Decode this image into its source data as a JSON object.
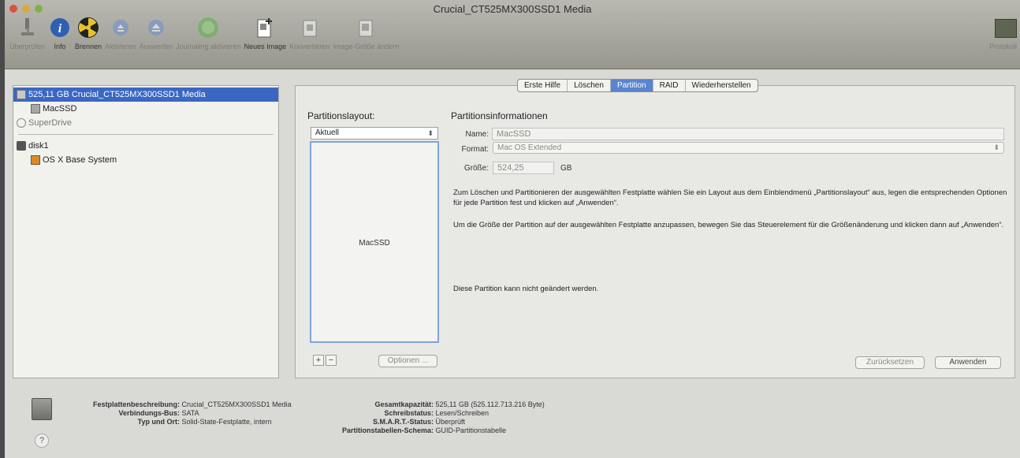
{
  "window": {
    "title": "Crucial_CT525MX300SSD1 Media"
  },
  "toolbar": {
    "items": [
      {
        "label": "Überprüfen",
        "icon": "microscope-icon",
        "disabled": true
      },
      {
        "label": "Info",
        "icon": "info-icon",
        "disabled": false
      },
      {
        "label": "Brennen",
        "icon": "burn-icon",
        "disabled": false
      },
      {
        "label": "Aktivieren",
        "icon": "mount-icon",
        "disabled": true
      },
      {
        "label": "Auswerfen",
        "icon": "eject-icon",
        "disabled": true
      },
      {
        "label": "Journaling aktivieren",
        "icon": "journaling-icon",
        "disabled": true
      },
      {
        "label": "Neues Image",
        "icon": "new-image-icon",
        "disabled": false
      },
      {
        "label": "Konvertieren",
        "icon": "convert-icon",
        "disabled": true
      },
      {
        "label": "Image-Größe ändern",
        "icon": "resize-image-icon",
        "disabled": true
      }
    ],
    "log_label": "Protokoll"
  },
  "sidebar": {
    "items": [
      {
        "label": "525,11 GB Crucial_CT525MX300SSD1 Media",
        "selected": true,
        "indent": 0,
        "icon": "disk-icon"
      },
      {
        "label": "MacSSD",
        "selected": false,
        "indent": 1,
        "icon": "volume-icon"
      },
      {
        "label": "SuperDrive",
        "selected": false,
        "indent": 0,
        "icon": "optical-drive-icon",
        "muted": true
      },
      {
        "separator": true
      },
      {
        "label": "disk1",
        "selected": false,
        "indent": 0,
        "icon": "image-disk-icon"
      },
      {
        "label": "OS X Base System",
        "selected": false,
        "indent": 1,
        "icon": "volume-orange-icon"
      }
    ]
  },
  "tabs": [
    "Erste Hilfe",
    "Löschen",
    "Partition",
    "RAID",
    "Wiederherstellen"
  ],
  "active_tab": "Partition",
  "layout": {
    "heading": "Partitionslayout:",
    "select_value": "Aktuell",
    "partition_label": "MacSSD",
    "add_label": "+",
    "remove_label": "−",
    "options_label": "Optionen ..."
  },
  "info": {
    "heading": "Partitionsinformationen",
    "name_label": "Name:",
    "name_value": "MacSSD",
    "format_label": "Format:",
    "format_value": "Mac OS Extended",
    "size_label": "Größe:",
    "size_value": "524,25",
    "size_unit": "GB",
    "para1": "Zum Löschen und Partitionieren der ausgewählten Festplatte wählen Sie ein Layout aus dem Einblendmenü „Partitionslayout“ aus, legen die entsprechenden Optionen für jede Partition fest und klicken auf „Anwenden“.",
    "para2": "Um die Größe der Partition auf der ausgewählten Festplatte anzupassen, bewegen Sie das Steuerelement für die Größenänderung und klicken dann auf „Anwenden“.",
    "para3": "Diese Partition kann nicht geändert werden.",
    "revert_label": "Zurücksetzen",
    "apply_label": "Anwenden"
  },
  "details": {
    "left": [
      {
        "key": "Festplattenbeschreibung:",
        "value": "Crucial_CT525MX300SSD1 Media"
      },
      {
        "key": "Verbindungs-Bus:",
        "value": "SATA"
      },
      {
        "key": "Typ und Ort:",
        "value": "Solid-State-Festplatte, intern"
      }
    ],
    "right": [
      {
        "key": "Gesamtkapazität:",
        "value": "525,11 GB (525.112.713.216 Byte)"
      },
      {
        "key": "Schreibstatus:",
        "value": "Lesen/Schreiben"
      },
      {
        "key": "S.M.A.R.T.-Status:",
        "value": "Überprüft"
      },
      {
        "key": "Partitionstabellen-Schema:",
        "value": "GUID-Partitionstabelle"
      }
    ],
    "help_label": "?"
  },
  "colors": {
    "accent": "#3a67c4",
    "tab_active": "#5a84cf",
    "partition_border": "#7da4d9"
  }
}
